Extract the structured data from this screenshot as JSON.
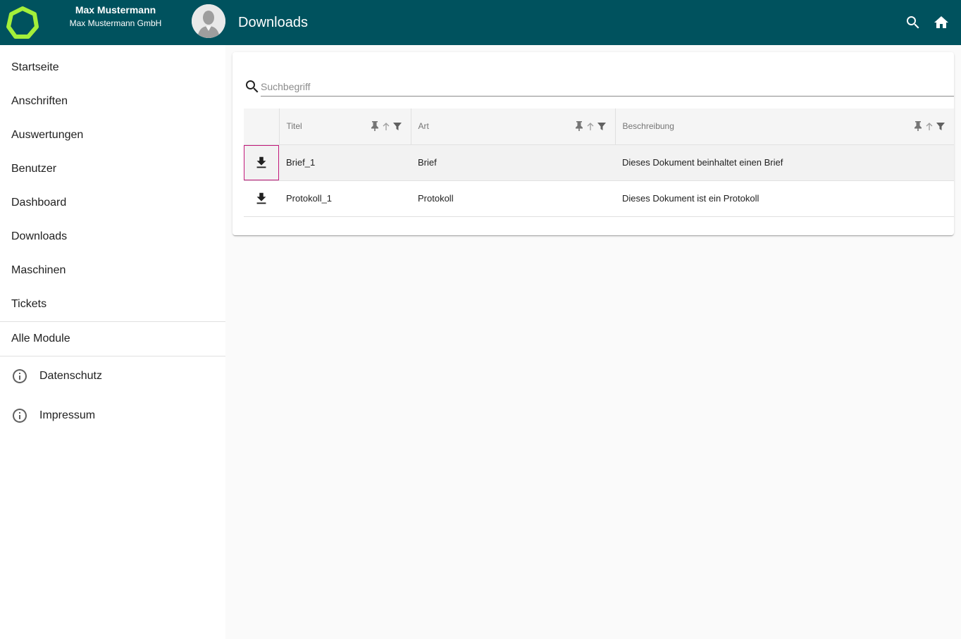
{
  "header": {
    "user_name": "Max Mustermann",
    "company": "Max Mustermann GmbH",
    "page_title": "Downloads",
    "bar_color": "#00525e",
    "logo_color": "#a4ef3a"
  },
  "sidebar": {
    "items": [
      {
        "label": "Startseite"
      },
      {
        "label": "Anschriften"
      },
      {
        "label": "Auswertungen"
      },
      {
        "label": "Benutzer"
      },
      {
        "label": "Dashboard"
      },
      {
        "label": "Downloads"
      },
      {
        "label": "Maschinen"
      },
      {
        "label": "Tickets"
      }
    ],
    "all_modules": "Alle Module",
    "info_links": [
      {
        "label": "Datenschutz",
        "icon": "info-icon"
      },
      {
        "label": "Impressum",
        "icon": "info-icon"
      }
    ]
  },
  "search": {
    "placeholder": "Suchbegriff",
    "value": ""
  },
  "table": {
    "columns": [
      {
        "label": "Titel"
      },
      {
        "label": "Art"
      },
      {
        "label": "Beschreibung"
      }
    ],
    "rows": [
      {
        "titel": "Brief_1",
        "art": "Brief",
        "beschreibung": "Dieses Dokument beinhaltet einen Brief",
        "selected": true
      },
      {
        "titel": "Protokoll_1",
        "art": "Protokoll",
        "beschreibung": "Dieses Dokument ist ein Protokoll",
        "selected": false
      }
    ],
    "focus_color": "#c2187b"
  }
}
